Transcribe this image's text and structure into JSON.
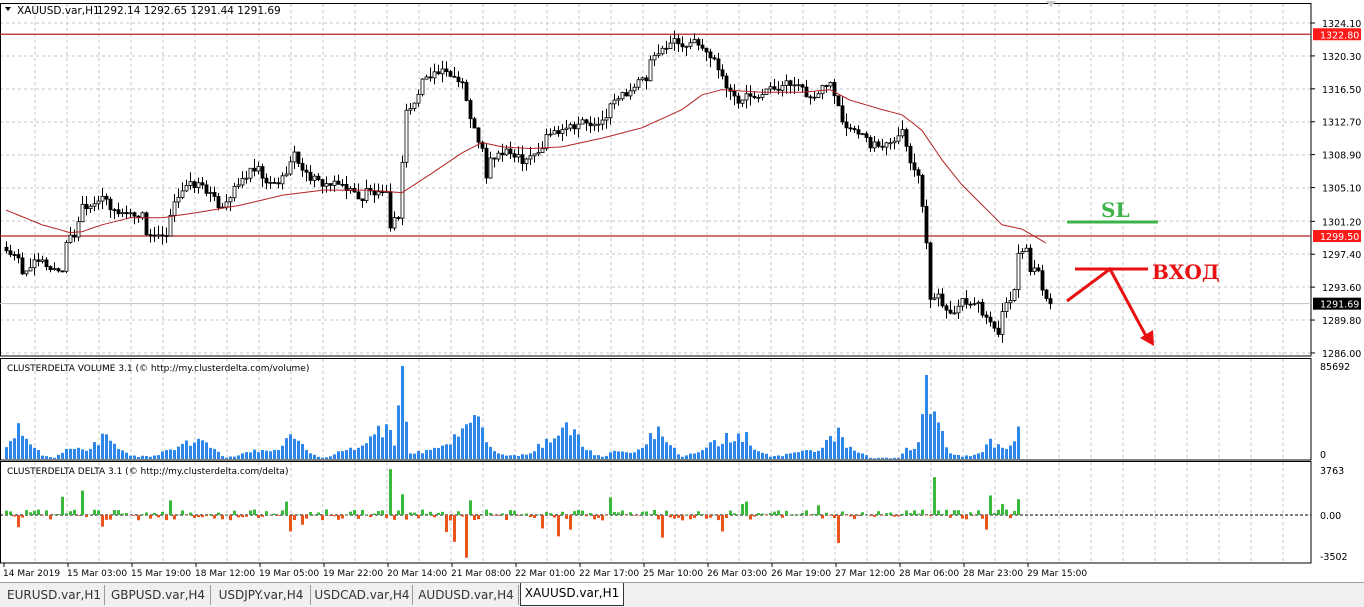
{
  "header": {
    "symbol": "XAUUSD.var,H1",
    "ohlc": "1292.14 1292.65 1291.44 1291.69"
  },
  "colors": {
    "ma": "#b22222",
    "level": "#b22222",
    "bull": "#ffffff",
    "bear": "#000000",
    "volume": "#2e86e8",
    "delta_pos": "#3cb93c",
    "delta_neg": "#e8561e",
    "sl": "#3cb34a",
    "entry": "#e81010"
  },
  "price_axis": {
    "ticks": [
      "1324.10",
      "1320.30",
      "1316.50",
      "1312.70",
      "1308.90",
      "1305.10",
      "1301.20",
      "1297.40",
      "1293.60",
      "1289.80",
      "1286.00"
    ],
    "tick_values": [
      1324.1,
      1320.3,
      1316.5,
      1312.7,
      1308.9,
      1305.1,
      1301.2,
      1297.4,
      1293.6,
      1289.8,
      1286.0
    ],
    "levels": [
      {
        "label": "1322.80",
        "value": 1322.8
      },
      {
        "label": "1299.50",
        "value": 1299.5
      }
    ],
    "current": {
      "label": "1291.69",
      "value": 1291.69
    }
  },
  "time_axis": [
    "14 Mar 2019",
    "15 Mar 03:00",
    "15 Mar 19:00",
    "18 Mar 12:00",
    "19 Mar 05:00",
    "19 Mar 22:00",
    "20 Mar 14:00",
    "21 Mar 08:00",
    "22 Mar 01:00",
    "22 Mar 17:00",
    "25 Mar 10:00",
    "26 Mar 03:00",
    "26 Mar 19:00",
    "27 Mar 12:00",
    "28 Mar 06:00",
    "28 Mar 23:00",
    "29 Mar 15:00"
  ],
  "indicators": {
    "volume": {
      "title": "CLUSTERDELTA VOLUME 3.1 (© http://my.clusterdelta.com/volume)",
      "max_label": "85692",
      "min_label": "0"
    },
    "delta": {
      "title": "CLUSTERDELTA DELTA 3.1 (© http://my.clusterdelta.com/delta)",
      "max_label": "3763",
      "zero_label": "0.00",
      "min_label": "-3502"
    }
  },
  "annotations": {
    "sl": "SL",
    "entry": "ВХОД"
  },
  "tabs": [
    {
      "label": "EURUSD.var,H1",
      "active": false
    },
    {
      "label": "GBPUSD.var,H4",
      "active": false
    },
    {
      "label": "USDJPY.var,H4",
      "active": false
    },
    {
      "label": "USDCAD.var,H4",
      "active": false
    },
    {
      "label": "AUDUSD.var,H4",
      "active": false
    },
    {
      "label": "XAUUSD.var,H1",
      "active": true
    }
  ],
  "chart_data": {
    "type": "candlestick",
    "title": "XAUUSD.var,H1",
    "bars": 262,
    "ylim": [
      1286.0,
      1324.1
    ],
    "close_keypoints": [
      [
        0,
        1297.9
      ],
      [
        3,
        1296.7
      ],
      [
        4,
        1295.0
      ],
      [
        6,
        1296.2
      ],
      [
        9,
        1296.5
      ],
      [
        11,
        1295.8
      ],
      [
        14,
        1295.5
      ],
      [
        15,
        1299.0
      ],
      [
        17,
        1299.6
      ],
      [
        19,
        1303.1
      ],
      [
        21,
        1303.1
      ],
      [
        24,
        1304.2
      ],
      [
        26,
        1302.5
      ],
      [
        29,
        1302.2
      ],
      [
        34,
        1301.9
      ],
      [
        35,
        1299.9
      ],
      [
        38,
        1299.3
      ],
      [
        40,
        1299.3
      ],
      [
        42,
        1303.7
      ],
      [
        44,
        1304.8
      ],
      [
        46,
        1305.4
      ],
      [
        49,
        1305.4
      ],
      [
        51,
        1304.2
      ],
      [
        53,
        1303.1
      ],
      [
        54,
        1303.1
      ],
      [
        56,
        1304.2
      ],
      [
        59,
        1306.0
      ],
      [
        61,
        1306.9
      ],
      [
        63,
        1307.1
      ],
      [
        65,
        1305.4
      ],
      [
        68,
        1305.7
      ],
      [
        69,
        1306.2
      ],
      [
        72,
        1308.9
      ],
      [
        73,
        1308.1
      ],
      [
        75,
        1306.6
      ],
      [
        78,
        1305.7
      ],
      [
        81,
        1305.4
      ],
      [
        84,
        1305.4
      ],
      [
        86,
        1304.8
      ],
      [
        89,
        1303.7
      ],
      [
        90,
        1304.8
      ],
      [
        93,
        1304.2
      ],
      [
        95,
        1304.2
      ],
      [
        96,
        1300.8
      ],
      [
        98,
        1301.9
      ],
      [
        100,
        1314.1
      ],
      [
        101,
        1314.1
      ],
      [
        103,
        1315.8
      ],
      [
        104,
        1317.5
      ],
      [
        105,
        1318.1
      ],
      [
        107,
        1318.3
      ],
      [
        109,
        1318.4
      ],
      [
        111,
        1318.1
      ],
      [
        113,
        1317.7
      ],
      [
        114,
        1317.3
      ],
      [
        115,
        1315.2
      ],
      [
        116,
        1312.9
      ],
      [
        118,
        1310.6
      ],
      [
        119,
        1309.4
      ],
      [
        120,
        1306.0
      ],
      [
        121,
        1308.3
      ],
      [
        123,
        1308.9
      ],
      [
        125,
        1309.1
      ],
      [
        128,
        1308.9
      ],
      [
        129,
        1308.3
      ],
      [
        131,
        1308.9
      ],
      [
        134,
        1309.4
      ],
      [
        135,
        1311.2
      ],
      [
        138,
        1311.7
      ],
      [
        140,
        1312.3
      ],
      [
        142,
        1312.3
      ],
      [
        144,
        1312.7
      ],
      [
        146,
        1312.3
      ],
      [
        148,
        1312.1
      ],
      [
        150,
        1313.5
      ],
      [
        151,
        1314.6
      ],
      [
        154,
        1315.8
      ],
      [
        156,
        1316.4
      ],
      [
        158,
        1317.3
      ],
      [
        160,
        1317.5
      ],
      [
        161,
        1319.6
      ],
      [
        163,
        1320.4
      ],
      [
        164,
        1321.0
      ],
      [
        165,
        1321.6
      ],
      [
        167,
        1322.1
      ],
      [
        169,
        1321.6
      ],
      [
        171,
        1321.9
      ],
      [
        173,
        1321.6
      ],
      [
        174,
        1321.2
      ],
      [
        175,
        1320.8
      ],
      [
        177,
        1319.8
      ],
      [
        179,
        1318.1
      ],
      [
        180,
        1316.4
      ],
      [
        182,
        1315.8
      ],
      [
        183,
        1315.2
      ],
      [
        185,
        1316.1
      ],
      [
        188,
        1315.8
      ],
      [
        190,
        1316.4
      ],
      [
        193,
        1316.6
      ],
      [
        194,
        1317.3
      ],
      [
        196,
        1316.9
      ],
      [
        199,
        1316.4
      ],
      [
        201,
        1315.4
      ],
      [
        203,
        1315.8
      ],
      [
        204,
        1316.9
      ],
      [
        206,
        1317.5
      ],
      [
        207,
        1316.1
      ],
      [
        209,
        1312.9
      ],
      [
        210,
        1312.3
      ],
      [
        212,
        1311.7
      ],
      [
        213,
        1311.7
      ],
      [
        215,
        1310.6
      ],
      [
        216,
        1310.0
      ],
      [
        219,
        1310.0
      ],
      [
        221,
        1310.6
      ],
      [
        223,
        1311.2
      ],
      [
        224,
        1311.7
      ],
      [
        225,
        1310.0
      ],
      [
        226,
        1308.3
      ],
      [
        228,
        1306.6
      ],
      [
        229,
        1302.5
      ],
      [
        230,
        1299.0
      ],
      [
        231,
        1292.1
      ],
      [
        233,
        1292.7
      ],
      [
        235,
        1291.0
      ],
      [
        238,
        1291.0
      ],
      [
        239,
        1292.1
      ],
      [
        241,
        1291.5
      ],
      [
        243,
        1292.1
      ],
      [
        244,
        1290.4
      ],
      [
        246,
        1289.2
      ],
      [
        248,
        1288.1
      ],
      [
        249,
        1290.4
      ],
      [
        250,
        1291.5
      ],
      [
        252,
        1293.3
      ],
      [
        253,
        1297.3
      ],
      [
        255,
        1298.5
      ],
      [
        256,
        1295.6
      ],
      [
        258,
        1295.3
      ],
      [
        259,
        1293.3
      ],
      [
        261,
        1291.69
      ]
    ],
    "ma_keypoints": [
      [
        0,
        1302.5
      ],
      [
        9,
        1300.8
      ],
      [
        16,
        1299.9
      ],
      [
        19,
        1300.0
      ],
      [
        24,
        1300.8
      ],
      [
        31,
        1301.6
      ],
      [
        39,
        1301.6
      ],
      [
        49,
        1302.3
      ],
      [
        59,
        1303.1
      ],
      [
        69,
        1304.2
      ],
      [
        79,
        1304.8
      ],
      [
        91,
        1304.8
      ],
      [
        99,
        1304.5
      ],
      [
        106,
        1306.6
      ],
      [
        114,
        1309.1
      ],
      [
        119,
        1310.3
      ],
      [
        124,
        1309.8
      ],
      [
        131,
        1309.6
      ],
      [
        139,
        1309.8
      ],
      [
        149,
        1310.8
      ],
      [
        159,
        1312.0
      ],
      [
        169,
        1314.1
      ],
      [
        174,
        1315.8
      ],
      [
        179,
        1316.4
      ],
      [
        189,
        1316.1
      ],
      [
        199,
        1316.1
      ],
      [
        206,
        1316.4
      ],
      [
        211,
        1315.2
      ],
      [
        219,
        1314.1
      ],
      [
        224,
        1313.5
      ],
      [
        229,
        1311.7
      ],
      [
        234,
        1308.3
      ],
      [
        239,
        1305.4
      ],
      [
        244,
        1303.1
      ],
      [
        249,
        1300.8
      ],
      [
        254,
        1300.3
      ],
      [
        260,
        1298.7
      ]
    ],
    "volume_keypoints": [
      [
        0,
        10600
      ],
      [
        3,
        32000
      ],
      [
        5,
        18000
      ],
      [
        7,
        10000
      ],
      [
        9,
        3000
      ],
      [
        12,
        1000
      ],
      [
        15,
        9000
      ],
      [
        18,
        10000
      ],
      [
        21,
        9000
      ],
      [
        25,
        22000
      ],
      [
        28,
        9000
      ],
      [
        31,
        3000
      ],
      [
        36,
        2000
      ],
      [
        40,
        8000
      ],
      [
        48,
        18000
      ],
      [
        52,
        9000
      ],
      [
        55,
        1000
      ],
      [
        59,
        5000
      ],
      [
        64,
        8000
      ],
      [
        68,
        8000
      ],
      [
        71,
        22000
      ],
      [
        75,
        8000
      ],
      [
        79,
        1000
      ],
      [
        84,
        7000
      ],
      [
        88,
        10000
      ],
      [
        92,
        22000
      ],
      [
        95,
        31000
      ],
      [
        97,
        12000
      ],
      [
        99,
        83000
      ],
      [
        101,
        5000
      ],
      [
        105,
        8000
      ],
      [
        109,
        12000
      ],
      [
        113,
        20000
      ],
      [
        118,
        38000
      ],
      [
        120,
        15000
      ],
      [
        123,
        5000
      ],
      [
        125,
        3000
      ],
      [
        131,
        5000
      ],
      [
        135,
        18000
      ],
      [
        139,
        28000
      ],
      [
        143,
        22000
      ],
      [
        145,
        8000
      ],
      [
        149,
        2000
      ],
      [
        151,
        6000
      ],
      [
        155,
        6000
      ],
      [
        159,
        10000
      ],
      [
        163,
        29000
      ],
      [
        165,
        15000
      ],
      [
        169,
        2000
      ],
      [
        173,
        6000
      ],
      [
        176,
        15000
      ],
      [
        185,
        24000
      ],
      [
        186,
        12000
      ],
      [
        191,
        2000
      ],
      [
        196,
        5000
      ],
      [
        200,
        8000
      ],
      [
        204,
        10000
      ],
      [
        208,
        28000
      ],
      [
        210,
        10000
      ],
      [
        214,
        5000
      ],
      [
        216,
        1000
      ],
      [
        223,
        1000
      ],
      [
        225,
        10000
      ],
      [
        228,
        15000
      ],
      [
        229,
        40000
      ],
      [
        230,
        75000
      ],
      [
        231,
        40000
      ],
      [
        234,
        25000
      ],
      [
        236,
        5000
      ],
      [
        239,
        2000
      ],
      [
        243,
        5000
      ],
      [
        246,
        18000
      ],
      [
        249,
        10000
      ],
      [
        251,
        12000
      ],
      [
        253,
        29000
      ]
    ],
    "delta_spikes": [
      [
        3,
        -1000
      ],
      [
        14,
        1500
      ],
      [
        19,
        2000
      ],
      [
        24,
        -950
      ],
      [
        41,
        1200
      ],
      [
        70,
        1100
      ],
      [
        71,
        -1350
      ],
      [
        74,
        -800
      ],
      [
        96,
        3763
      ],
      [
        99,
        1700
      ],
      [
        110,
        -1400
      ],
      [
        112,
        -2200
      ],
      [
        115,
        -3502
      ],
      [
        116,
        1200
      ],
      [
        134,
        -1100
      ],
      [
        138,
        -1750
      ],
      [
        141,
        -1200
      ],
      [
        151,
        1450
      ],
      [
        164,
        -1850
      ],
      [
        179,
        -1350
      ],
      [
        184,
        900
      ],
      [
        185,
        1100
      ],
      [
        203,
        800
      ],
      [
        208,
        -2300
      ],
      [
        232,
        3100
      ],
      [
        245,
        -1200
      ],
      [
        246,
        1600
      ],
      [
        249,
        900
      ],
      [
        253,
        1300
      ]
    ]
  }
}
